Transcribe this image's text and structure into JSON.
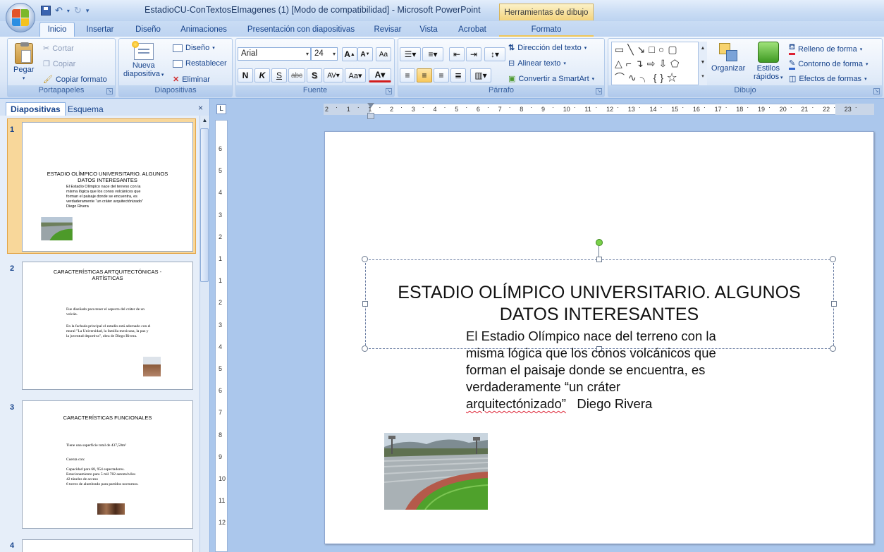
{
  "window": {
    "title": "EstadioCU-ConTextosEImagenes (1) [Modo de compatibilidad] - Microsoft PowerPoint",
    "contextual_tab_header": "Herramientas de dibujo"
  },
  "tabs": [
    {
      "label": "Inicio",
      "active": true
    },
    {
      "label": "Insertar"
    },
    {
      "label": "Diseño"
    },
    {
      "label": "Animaciones"
    },
    {
      "label": "Presentación con diapositivas"
    },
    {
      "label": "Revisar"
    },
    {
      "label": "Vista"
    },
    {
      "label": "Acrobat"
    },
    {
      "label": "Formato"
    }
  ],
  "ribbon": {
    "portapapeles": {
      "label": "Portapapeles",
      "paste": "Pegar",
      "cut": "Cortar",
      "copy": "Copiar",
      "format_painter": "Copiar formato"
    },
    "diapositivas": {
      "label": "Diapositivas",
      "new_slide_1": "Nueva",
      "new_slide_2": "diapositiva",
      "layout": "Diseño",
      "reset": "Restablecer",
      "delete": "Eliminar"
    },
    "fuente": {
      "label": "Fuente",
      "font_name": "Arial",
      "font_size": "24"
    },
    "parrafo": {
      "label": "Párrafo",
      "text_direction": "Dirección del texto",
      "align_text": "Alinear texto",
      "smartart": "Convertir a SmartArt"
    },
    "dibujo": {
      "label": "Dibujo",
      "arrange": "Organizar",
      "quick_styles_1": "Estilos",
      "quick_styles_2": "rápidos",
      "shape_fill": "Relleno de forma",
      "shape_outline": "Contorno de forma",
      "shape_effects": "Efectos de formas"
    }
  },
  "slides_pane": {
    "tab_slides": "Diapositivas",
    "tab_outline": "Esquema",
    "thumbnails": [
      {
        "num": "1",
        "title": "ESTADIO OLÍMPICO UNIVERSITARIO.  ALGUNOS DATOS INTERESANTES",
        "body": "El Estadio Olímpico nace del terreno con la misma lógica que los conos volcánicos que forman el paisaje donde se encuentra,  es verdaderamente “un cráter arquitectónizado”   Diego Rivera"
      },
      {
        "num": "2",
        "title": "CARACTERÍSTICAS ARTQUITECTÓNICAS - ARTÍSTICAS",
        "body1": "Fue diseñado para tener el aspecto del cráter de un volcán.",
        "body2": "En la fachada principal el estadio está adornado con el mural \"La Universidad, la familia mexicana, la paz y la juventud deportiva\", obra de Diego Rivera."
      },
      {
        "num": "3",
        "title": "CARACTERÍSTICAS FUNCIONALES",
        "b1": "Tiene una superficie total de 437,50m²",
        "b2": "Cuenta con:",
        "b3": "Capacidad para 68, 954 espectadores.",
        "b4": "Estacionamiento para 5 mil 782 automóviles",
        "b5": "42 túneles de acceso",
        "b6": "6 torres de alumbrado para partidos nocturnos."
      },
      {
        "num": "4"
      }
    ]
  },
  "ruler": {
    "h_ticks": [
      "2",
      "1",
      "1",
      "2",
      "3",
      "4",
      "5",
      "6",
      "7",
      "8",
      "9",
      "10",
      "11",
      "12",
      "13",
      "14",
      "15",
      "16",
      "17",
      "18",
      "19",
      "20",
      "21",
      "22",
      "23"
    ],
    "v_ticks": [
      "6",
      "5",
      "4",
      "3",
      "2",
      "1",
      "1",
      "2",
      "3",
      "4",
      "5",
      "6",
      "7",
      "8",
      "9",
      "10",
      "11",
      "12"
    ]
  },
  "slide": {
    "title": "ESTADIO OLÍMPICO UNIVERSITARIO.  ALGUNOS DATOS INTERESANTES",
    "body_line1": "El Estadio Olímpico nace del terreno con la",
    "body_line2": "misma lógica que los conos volcánicos que",
    "body_line3": "forman el paisaje donde se encuentra,  es",
    "body_line4": "verdaderamente “un cráter",
    "body_line5_word": "arquitectónizado”",
    "body_line5_rest": "   Diego Rivera"
  }
}
